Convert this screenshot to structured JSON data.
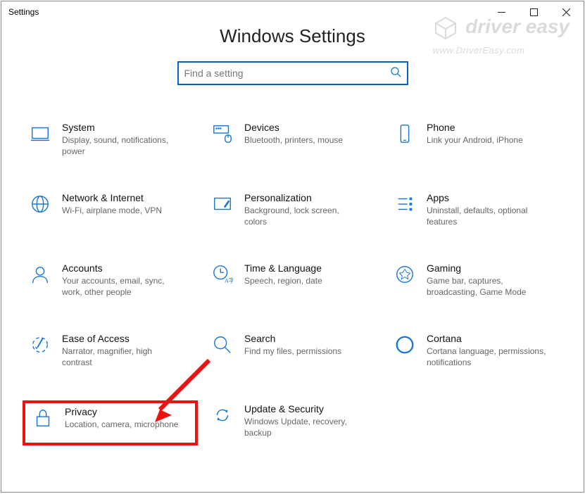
{
  "window": {
    "title": "Settings"
  },
  "header": {
    "title": "Windows Settings"
  },
  "search": {
    "placeholder": "Find a setting"
  },
  "watermark": {
    "brand": "driver easy",
    "url": "www.DriverEasy.com"
  },
  "tiles": [
    {
      "title": "System",
      "desc": "Display, sound, notifications, power"
    },
    {
      "title": "Devices",
      "desc": "Bluetooth, printers, mouse"
    },
    {
      "title": "Phone",
      "desc": "Link your Android, iPhone"
    },
    {
      "title": "Network & Internet",
      "desc": "Wi-Fi, airplane mode, VPN"
    },
    {
      "title": "Personalization",
      "desc": "Background, lock screen, colors"
    },
    {
      "title": "Apps",
      "desc": "Uninstall, defaults, optional features"
    },
    {
      "title": "Accounts",
      "desc": "Your accounts, email, sync, work, other people"
    },
    {
      "title": "Time & Language",
      "desc": "Speech, region, date"
    },
    {
      "title": "Gaming",
      "desc": "Game bar, captures, broadcasting, Game Mode"
    },
    {
      "title": "Ease of Access",
      "desc": "Narrator, magnifier, high contrast"
    },
    {
      "title": "Search",
      "desc": "Find my files, permissions"
    },
    {
      "title": "Cortana",
      "desc": "Cortana language, permissions, notifications"
    },
    {
      "title": "Privacy",
      "desc": "Location, camera, microphone"
    },
    {
      "title": "Update & Security",
      "desc": "Windows Update, recovery, backup"
    }
  ]
}
